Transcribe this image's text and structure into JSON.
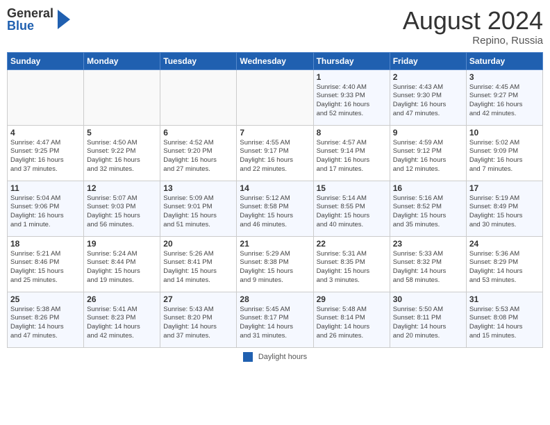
{
  "header": {
    "logo_general": "General",
    "logo_blue": "Blue",
    "month_title": "August 2024",
    "location": "Repino, Russia"
  },
  "weekdays": [
    "Sunday",
    "Monday",
    "Tuesday",
    "Wednesday",
    "Thursday",
    "Friday",
    "Saturday"
  ],
  "legend": {
    "label": "Daylight hours"
  },
  "weeks": [
    [
      {
        "day": "",
        "info": ""
      },
      {
        "day": "",
        "info": ""
      },
      {
        "day": "",
        "info": ""
      },
      {
        "day": "",
        "info": ""
      },
      {
        "day": "1",
        "info": "Sunrise: 4:40 AM\nSunset: 9:33 PM\nDaylight: 16 hours\nand 52 minutes."
      },
      {
        "day": "2",
        "info": "Sunrise: 4:43 AM\nSunset: 9:30 PM\nDaylight: 16 hours\nand 47 minutes."
      },
      {
        "day": "3",
        "info": "Sunrise: 4:45 AM\nSunset: 9:27 PM\nDaylight: 16 hours\nand 42 minutes."
      }
    ],
    [
      {
        "day": "4",
        "info": "Sunrise: 4:47 AM\nSunset: 9:25 PM\nDaylight: 16 hours\nand 37 minutes."
      },
      {
        "day": "5",
        "info": "Sunrise: 4:50 AM\nSunset: 9:22 PM\nDaylight: 16 hours\nand 32 minutes."
      },
      {
        "day": "6",
        "info": "Sunrise: 4:52 AM\nSunset: 9:20 PM\nDaylight: 16 hours\nand 27 minutes."
      },
      {
        "day": "7",
        "info": "Sunrise: 4:55 AM\nSunset: 9:17 PM\nDaylight: 16 hours\nand 22 minutes."
      },
      {
        "day": "8",
        "info": "Sunrise: 4:57 AM\nSunset: 9:14 PM\nDaylight: 16 hours\nand 17 minutes."
      },
      {
        "day": "9",
        "info": "Sunrise: 4:59 AM\nSunset: 9:12 PM\nDaylight: 16 hours\nand 12 minutes."
      },
      {
        "day": "10",
        "info": "Sunrise: 5:02 AM\nSunset: 9:09 PM\nDaylight: 16 hours\nand 7 minutes."
      }
    ],
    [
      {
        "day": "11",
        "info": "Sunrise: 5:04 AM\nSunset: 9:06 PM\nDaylight: 16 hours\nand 1 minute."
      },
      {
        "day": "12",
        "info": "Sunrise: 5:07 AM\nSunset: 9:03 PM\nDaylight: 15 hours\nand 56 minutes."
      },
      {
        "day": "13",
        "info": "Sunrise: 5:09 AM\nSunset: 9:01 PM\nDaylight: 15 hours\nand 51 minutes."
      },
      {
        "day": "14",
        "info": "Sunrise: 5:12 AM\nSunset: 8:58 PM\nDaylight: 15 hours\nand 46 minutes."
      },
      {
        "day": "15",
        "info": "Sunrise: 5:14 AM\nSunset: 8:55 PM\nDaylight: 15 hours\nand 40 minutes."
      },
      {
        "day": "16",
        "info": "Sunrise: 5:16 AM\nSunset: 8:52 PM\nDaylight: 15 hours\nand 35 minutes."
      },
      {
        "day": "17",
        "info": "Sunrise: 5:19 AM\nSunset: 8:49 PM\nDaylight: 15 hours\nand 30 minutes."
      }
    ],
    [
      {
        "day": "18",
        "info": "Sunrise: 5:21 AM\nSunset: 8:46 PM\nDaylight: 15 hours\nand 25 minutes."
      },
      {
        "day": "19",
        "info": "Sunrise: 5:24 AM\nSunset: 8:44 PM\nDaylight: 15 hours\nand 19 minutes."
      },
      {
        "day": "20",
        "info": "Sunrise: 5:26 AM\nSunset: 8:41 PM\nDaylight: 15 hours\nand 14 minutes."
      },
      {
        "day": "21",
        "info": "Sunrise: 5:29 AM\nSunset: 8:38 PM\nDaylight: 15 hours\nand 9 minutes."
      },
      {
        "day": "22",
        "info": "Sunrise: 5:31 AM\nSunset: 8:35 PM\nDaylight: 15 hours\nand 3 minutes."
      },
      {
        "day": "23",
        "info": "Sunrise: 5:33 AM\nSunset: 8:32 PM\nDaylight: 14 hours\nand 58 minutes."
      },
      {
        "day": "24",
        "info": "Sunrise: 5:36 AM\nSunset: 8:29 PM\nDaylight: 14 hours\nand 53 minutes."
      }
    ],
    [
      {
        "day": "25",
        "info": "Sunrise: 5:38 AM\nSunset: 8:26 PM\nDaylight: 14 hours\nand 47 minutes."
      },
      {
        "day": "26",
        "info": "Sunrise: 5:41 AM\nSunset: 8:23 PM\nDaylight: 14 hours\nand 42 minutes."
      },
      {
        "day": "27",
        "info": "Sunrise: 5:43 AM\nSunset: 8:20 PM\nDaylight: 14 hours\nand 37 minutes."
      },
      {
        "day": "28",
        "info": "Sunrise: 5:45 AM\nSunset: 8:17 PM\nDaylight: 14 hours\nand 31 minutes."
      },
      {
        "day": "29",
        "info": "Sunrise: 5:48 AM\nSunset: 8:14 PM\nDaylight: 14 hours\nand 26 minutes."
      },
      {
        "day": "30",
        "info": "Sunrise: 5:50 AM\nSunset: 8:11 PM\nDaylight: 14 hours\nand 20 minutes."
      },
      {
        "day": "31",
        "info": "Sunrise: 5:53 AM\nSunset: 8:08 PM\nDaylight: 14 hours\nand 15 minutes."
      }
    ]
  ]
}
